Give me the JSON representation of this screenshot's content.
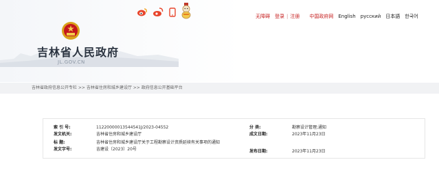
{
  "header": {
    "title": "吉林省人民政府",
    "domain": "JL.GOV.CN",
    "social_icons": [
      "weibo-icon",
      "weibo-alt-icon",
      "phone-icon",
      "mascot-icon"
    ],
    "links": [
      {
        "label": "无障碍",
        "color": "#c61f1f"
      },
      {
        "label": "登录",
        "color": "#c61f1f"
      },
      {
        "label": "注册",
        "color": "#c61f1f"
      },
      {
        "label": "中国政府网",
        "color": "#c61f1f"
      },
      {
        "label": "English",
        "color": "#222222"
      },
      {
        "label": "русский",
        "color": "#222222"
      },
      {
        "label": "日本語",
        "color": "#222222"
      },
      {
        "label": "한국어",
        "color": "#222222"
      }
    ]
  },
  "breadcrumb": "吉林省政府信息公开专栏 >> 吉林省住房和城乡建设厅 >> 政府信息公开基础平台",
  "meta": {
    "index_label": "索 引 号:",
    "index_value": "11220000013544541J/2023-04552",
    "category_label": "分 类:",
    "category_value": "勘察设计管理;通知",
    "issuer_label": "发文机关:",
    "issuer_value": "吉林省住房和城乡建设厅",
    "created_label": "成文日期:",
    "created_value": "2023年11月23日",
    "title_label": "标    题:",
    "title_value": "吉林省住房和城乡建设厅关于工程勘察设计资质延续有关事项的通知",
    "docno_label": "发文字号:",
    "docno_value": "吉建设〔2023〕20号",
    "published_label": "发布日期:",
    "published_value": "2023年11月23日"
  },
  "colors": {
    "accent_red": "#c61f1f",
    "bar_bg": "#f1f2f4"
  }
}
